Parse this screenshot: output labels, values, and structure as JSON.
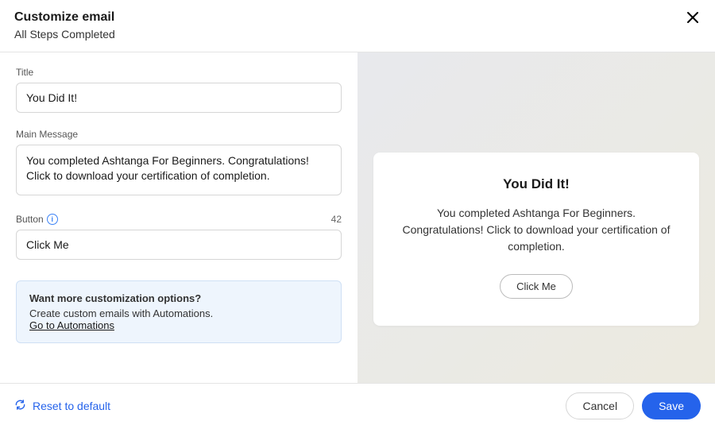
{
  "header": {
    "title": "Customize email",
    "subtitle": "All Steps Completed"
  },
  "form": {
    "title_label": "Title",
    "title_value": "You Did It!",
    "message_label": "Main Message",
    "message_value": "You completed Ashtanga For Beginners. Congratulations! Click to download your certification of completion.",
    "button_label": "Button",
    "button_value": "Click Me",
    "button_char_count": "42"
  },
  "callout": {
    "title": "Want more customization options?",
    "body": "Create custom emails with Automations.",
    "link": "Go to Automations"
  },
  "preview": {
    "title": "You Did It!",
    "body": "You completed Ashtanga For Beginners. Congratulations! Click to download your certification of completion.",
    "button": "Click Me"
  },
  "footer": {
    "reset": "Reset to default",
    "cancel": "Cancel",
    "save": "Save"
  }
}
